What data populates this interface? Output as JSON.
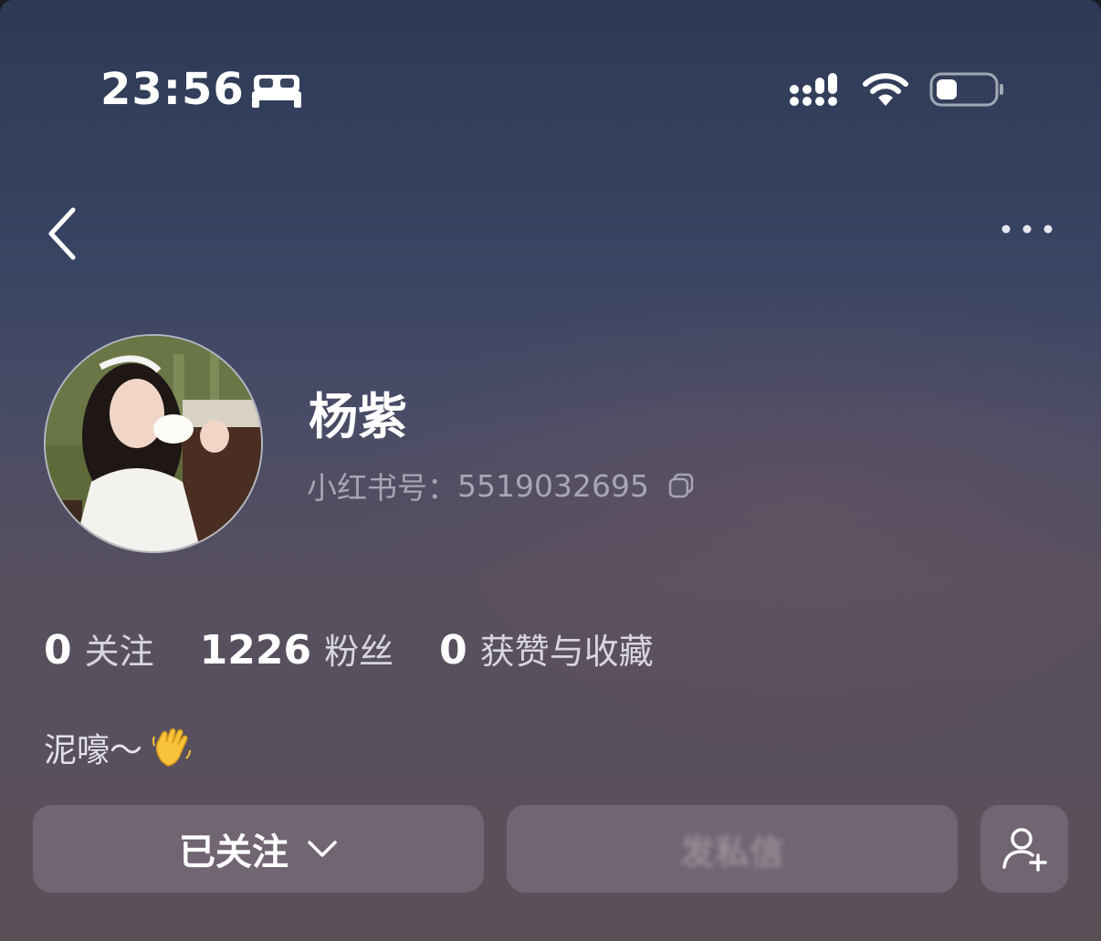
{
  "status_bar": {
    "time": "23:56",
    "focus_mode_icon": "bed-icon",
    "signal_icon": "cellular-signal-icon",
    "wifi_icon": "wifi-icon",
    "battery_icon": "battery-icon",
    "battery_level": 0.35
  },
  "nav": {
    "back_icon": "chevron-left-icon",
    "more_icon": "more-dots-icon"
  },
  "profile": {
    "name": "杨紫",
    "account_label": "小红书号：",
    "account_id": "5519032695",
    "copy_icon": "copy-icon"
  },
  "stats": [
    {
      "value": "0",
      "label": "关注"
    },
    {
      "value": "1226",
      "label": "粉丝"
    },
    {
      "value": "0",
      "label": "获赞与收藏"
    }
  ],
  "bio": {
    "text": "泥嚎～",
    "emoji_icon": "waving-hand-icon"
  },
  "actions": {
    "follow_label": "已关注",
    "message_label": "发私信",
    "add_friend_icon": "add-user-icon"
  },
  "colors": {
    "background_top": "#2e3a55",
    "background_bottom": "#5a5058",
    "secondary_text": "#a7a6b3",
    "button_bg": "#6e626f"
  }
}
